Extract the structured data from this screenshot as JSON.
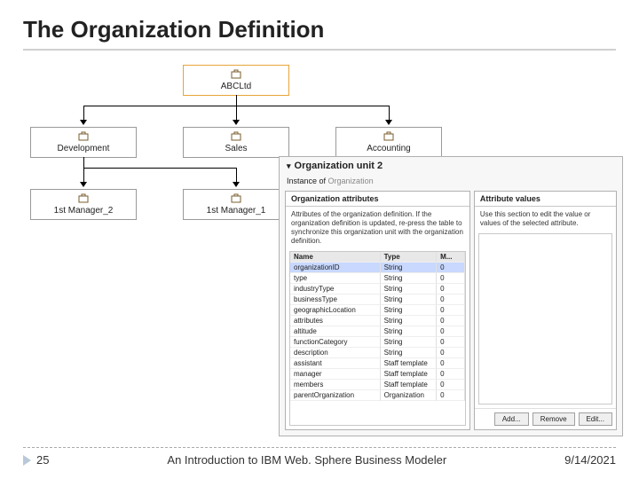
{
  "title": "The Organization Definition",
  "org": {
    "root": "ABCLtd",
    "level2": [
      "Development",
      "Sales",
      "Accounting"
    ],
    "level3": [
      "1st Manager_2",
      "1st Manager_1"
    ]
  },
  "panel": {
    "heading": "Organization unit 2",
    "instance_label": "Instance of",
    "instance_value": "Organization",
    "left": {
      "title": "Organization attributes",
      "desc": "Attributes of the organization definition. If the organization definition is updated, re-press the table to synchronize this organization unit with the organization definition.",
      "cols": [
        "Name",
        "Type",
        "M..."
      ],
      "rows": [
        [
          "organizationID",
          "String",
          "0"
        ],
        [
          "type",
          "String",
          "0"
        ],
        [
          "industryType",
          "String",
          "0"
        ],
        [
          "businessType",
          "String",
          "0"
        ],
        [
          "geographicLocation",
          "String",
          "0"
        ],
        [
          "attributes",
          "String",
          "0"
        ],
        [
          "altitude",
          "String",
          "0"
        ],
        [
          "functionCategory",
          "String",
          "0"
        ],
        [
          "description",
          "String",
          "0"
        ],
        [
          "assistant",
          "Staff template",
          "0"
        ],
        [
          "manager",
          "Staff template",
          "0"
        ],
        [
          "members",
          "Staff template",
          "0"
        ],
        [
          "parentOrganization",
          "Organization",
          "0"
        ]
      ]
    },
    "right": {
      "title": "Attribute values",
      "desc": "Use this section to edit the value or values of the selected attribute.",
      "add": "Add...",
      "remove": "Remove",
      "edit": "Edit..."
    }
  },
  "footer": {
    "page": "25",
    "center": "An Introduction to IBM Web. Sphere Business Modeler",
    "date": "9/14/2021"
  }
}
